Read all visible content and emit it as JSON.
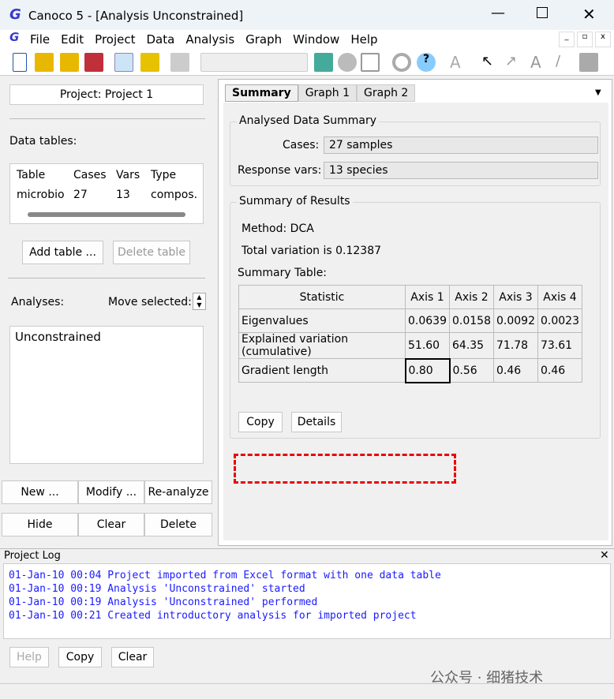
{
  "window": {
    "title": "Canoco 5 - [Analysis Unconstrained]",
    "logo": "C5"
  },
  "menu": [
    "File",
    "Edit",
    "Project",
    "Data",
    "Analysis",
    "Graph",
    "Window",
    "Help"
  ],
  "left": {
    "project_button": "Project: Project 1",
    "data_tables_label": "Data tables:",
    "table_headers": [
      "Table",
      "Cases",
      "Vars",
      "Type"
    ],
    "table_row": [
      "microbio",
      "27",
      "13",
      "compos."
    ],
    "add_table": "Add table ...",
    "delete_table": "Delete table",
    "analyses_label": "Analyses:",
    "move_selected": "Move selected:",
    "analyses": [
      "Unconstrained"
    ],
    "new": "New ...",
    "modify": "Modify ...",
    "reanalyze": "Re-analyze",
    "hide": "Hide",
    "clear": "Clear",
    "delete": "Delete"
  },
  "tabs": [
    "Summary",
    "Graph 1",
    "Graph 2"
  ],
  "summary": {
    "analysed_title": "Analysed Data Summary",
    "cases_label": "Cases:",
    "cases_value": "27 samples",
    "resp_label": "Response vars:",
    "resp_value": "13 species",
    "results_title": "Summary of Results",
    "method": "Method:  DCA",
    "total_variation": "Total variation is 0.12387",
    "table_label": "Summary Table:",
    "headers": [
      "Statistic",
      "Axis 1",
      "Axis 2",
      "Axis 3",
      "Axis 4"
    ],
    "rows": [
      [
        "Eigenvalues",
        "0.0639",
        "0.0158",
        "0.0092",
        "0.0023"
      ],
      [
        "Explained variation (cumulative)",
        "51.60",
        "64.35",
        "71.78",
        "73.61"
      ],
      [
        "Gradient length",
        "0.80",
        "0.56",
        "0.46",
        "0.46"
      ]
    ],
    "copy": "Copy",
    "details": "Details"
  },
  "log": {
    "title": "Project Log",
    "lines": [
      "01-Jan-10 00:04 Project imported from Excel format with one data table",
      "01-Jan-10 00:19 Analysis 'Unconstrained' started",
      "01-Jan-10 00:19 Analysis 'Unconstrained' performed",
      "01-Jan-10 00:21 Created introductory analysis for imported project"
    ],
    "help": "Help",
    "copy": "Copy",
    "clear": "Clear"
  },
  "watermark": "公众号 · 细猪技术"
}
